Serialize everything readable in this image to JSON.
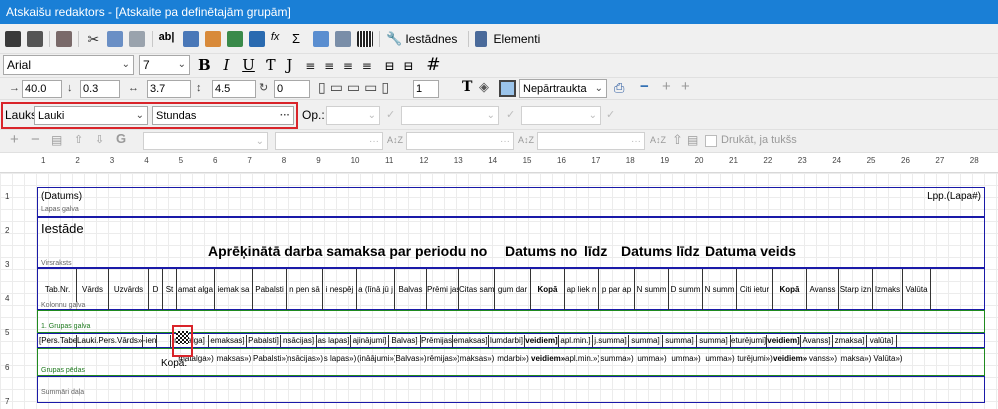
{
  "window": {
    "title": "Atskaišu redaktors - [Atskaite pa definētajām grupām]"
  },
  "toolbar1": {
    "iestades": "Iestādnes",
    "elementi": "Elementi"
  },
  "toolbar2": {
    "font": "Arial",
    "size": "7",
    "bold": "B",
    "italic": "I",
    "underline": "U",
    "hash": "#"
  },
  "toolbar3": {
    "v1": "40.0",
    "v2": "0.3",
    "v3": "3.7",
    "v4": "4.5",
    "v5": "0",
    "v6": "1",
    "border_style": "Nepārtraukta",
    "minus": "−",
    "plus1": "+",
    "plus2": "+"
  },
  "toolbar4": {
    "lauks_label": "Lauks:",
    "lauks_value": "Lauki",
    "field_value": "Stundas",
    "dots": "···",
    "op_label": "Op.:"
  },
  "toolbar5": {
    "plus": "+",
    "minus": "−",
    "print_if_empty": "Drukāt, ja tukšs"
  },
  "ruler": [
    "1",
    "2",
    "3",
    "4",
    "5",
    "6",
    "7",
    "8",
    "9",
    "10",
    "11",
    "12",
    "13",
    "14",
    "15",
    "16",
    "17",
    "18",
    "19",
    "20",
    "21",
    "22",
    "23",
    "24",
    "25",
    "26",
    "27",
    "28"
  ],
  "margins": [
    "1",
    "2",
    "3",
    "4",
    "5",
    "6",
    "7"
  ],
  "report": {
    "datums": "(Datums)",
    "lapas_galva": "Lapas galva",
    "lpp": "Lpp.(Lapa#)",
    "iestade": "Iestāde",
    "title": "Aprēķinātā darba samaksa par periodu no",
    "datums_no": "Datums no",
    "lidz": "līdz",
    "datums_lidz": "Datums līdz",
    "datuma_veids": "Datuma veids",
    "virsraksts": "Virsraksts",
    "kolonnu_galva": "Kolonnu galva",
    "grupas_galva": "1. Grupas galva",
    "grupas_pedas": "Grupas pēdas",
    "summari_dala": "Summāri daļa",
    "kopa": "Kopā:"
  },
  "columns": {
    "headers": [
      "Tab.Nr.",
      "Vārds",
      "Uzvārds",
      "D",
      "St",
      "amat alga",
      "iemak sa",
      "Pabalsti",
      "n pen sā",
      "i nespēj",
      "a (līnā jū j",
      "Balvas",
      "Prēmi jas",
      "Citas sam",
      "gum dar",
      "Kopā",
      "ap liek n",
      "p par ap",
      "N summ",
      "D summ",
      "N summ",
      "Citi ietur",
      "Kopā",
      "Avanss",
      "Starp izn",
      "Izmaks",
      "Valūta"
    ],
    "detail": [
      "[Pers.Tabe",
      "Lauki.Pers.Vārds»",
      "-ien",
      "",
      "matalga]",
      "emaksas]",
      "Pabalsti]",
      "nsācijas]",
      "as lapas]",
      "ajinājumi]",
      "Balvas]",
      "Prēmijas]",
      "emaksas]",
      "lumdarbi]",
      "veidiem]",
      "apl.min.]",
      "j.summa]",
      "summa]",
      "summa]",
      "summa]",
      "eturējumi]",
      "veidiem]",
      "Avanss]",
      "zmaksa]",
      "valūta]"
    ],
    "footer": [
      "",
      "",
      "",
      "",
      "",
      "matalga»)",
      "maksas»)",
      "Pabalsti»)",
      "nsācijas»)",
      "s lapas»)",
      "(ināājumi»)",
      "Balvas»)",
      "rēmijas»)",
      "maksas»)",
      "mdarbi»)",
      "veidiem»)",
      "apl.min.»)",
      "summa»)",
      "umma»)",
      "umma»)",
      "umma»)",
      "turējumi»)",
      "veidiem»)",
      "vanss»)",
      "maksa»)",
      "Valūta»)"
    ]
  }
}
